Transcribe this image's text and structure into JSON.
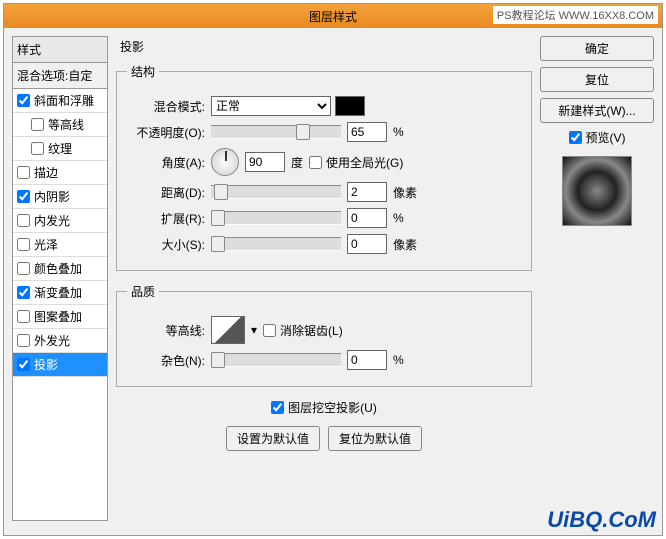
{
  "title": "图层样式",
  "watermark_top": "PS教程论坛  WWW.16XX8.COM",
  "sidebar": {
    "header": "样式",
    "subheader": "混合选项:自定",
    "items": [
      {
        "label": "斜面和浮雕",
        "checked": true
      },
      {
        "label": "等高线",
        "checked": false,
        "indent": true
      },
      {
        "label": "纹理",
        "checked": false,
        "indent": true
      },
      {
        "label": "描边",
        "checked": false
      },
      {
        "label": "内阴影",
        "checked": true
      },
      {
        "label": "内发光",
        "checked": false
      },
      {
        "label": "光泽",
        "checked": false
      },
      {
        "label": "颜色叠加",
        "checked": false
      },
      {
        "label": "渐变叠加",
        "checked": true
      },
      {
        "label": "图案叠加",
        "checked": false
      },
      {
        "label": "外发光",
        "checked": false
      },
      {
        "label": "投影",
        "checked": true,
        "selected": true
      }
    ]
  },
  "panel": {
    "title": "投影",
    "structure": {
      "legend": "结构",
      "blend_label": "混合模式:",
      "blend_value": "正常",
      "opacity_label": "不透明度(O):",
      "opacity_value": "65",
      "pct": "%",
      "angle_label": "角度(A):",
      "angle_value": "90",
      "angle_unit": "度",
      "global_light": "使用全局光(G)",
      "distance_label": "距离(D):",
      "distance_value": "2",
      "px": "像素",
      "spread_label": "扩展(R):",
      "spread_value": "0",
      "size_label": "大小(S):",
      "size_value": "0"
    },
    "quality": {
      "legend": "品质",
      "contour_label": "等高线:",
      "antialias": "消除锯齿(L)",
      "noise_label": "杂色(N):",
      "noise_value": "0"
    },
    "knockout": "图层挖空投影(U)",
    "set_default": "设置为默认值",
    "reset_default": "复位为默认值"
  },
  "actions": {
    "ok": "确定",
    "cancel": "复位",
    "new_style": "新建样式(W)...",
    "preview": "预览(V)"
  },
  "watermark": "UiBQ.CoM"
}
